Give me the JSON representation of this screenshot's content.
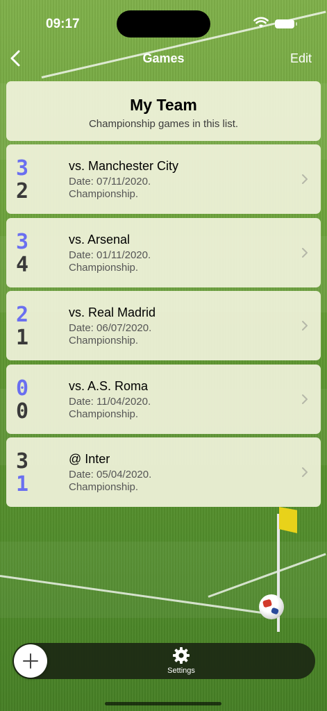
{
  "status": {
    "time": "09:17"
  },
  "nav": {
    "title": "Games",
    "edit_label": "Edit"
  },
  "header": {
    "title": "My Team",
    "subtitle": "Championship games in this list."
  },
  "games": [
    {
      "score_us": "3",
      "score_them": "2",
      "us_on_top": true,
      "opponent": "vs. Manchester City",
      "date": "Date: 07/11/2020.",
      "competition": "Championship."
    },
    {
      "score_us": "3",
      "score_them": "4",
      "us_on_top": true,
      "opponent": "vs. Arsenal",
      "date": "Date: 01/11/2020.",
      "competition": "Championship."
    },
    {
      "score_us": "2",
      "score_them": "1",
      "us_on_top": true,
      "opponent": "vs. Real Madrid",
      "date": "Date: 06/07/2020.",
      "competition": "Championship."
    },
    {
      "score_us": "0",
      "score_them": "0",
      "us_on_top": true,
      "opponent": "vs. A.S. Roma",
      "date": "Date: 11/04/2020.",
      "competition": "Championship."
    },
    {
      "score_us": "1",
      "score_them": "3",
      "us_on_top": false,
      "opponent": "@ Inter",
      "date": "Date: 05/04/2020.",
      "competition": "Championship."
    }
  ],
  "tabbar": {
    "settings_label": "Settings"
  },
  "colors": {
    "our_score": "#6a6ff0",
    "their_score": "#3a3a3a",
    "card_bg": "#f0f2da",
    "tabbar_bg": "#1c2814"
  },
  "icons": [
    "back-chevron-icon",
    "wifi-icon",
    "battery-icon",
    "chevron-right-icon",
    "plus-icon",
    "gear-icon"
  ]
}
